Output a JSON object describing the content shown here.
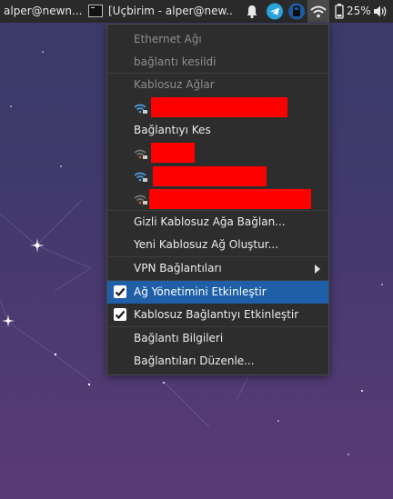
{
  "panel": {
    "tasks": [
      {
        "label": "alper@newn..."
      },
      {
        "label": "[Uçbirim - alper@new..."
      }
    ],
    "battery_percent": "25%"
  },
  "network_menu": {
    "ethernet_header": "Ethernet Ağı",
    "ethernet_status": "bağlantı kesildi",
    "wireless_header": "Kablosuz Ağlar",
    "disconnect_label": "Bağlantıyı Kes",
    "hidden_wifi_label": "Gizli Kablosuz Ağa Bağlan...",
    "new_wifi_label": "Yeni Kablosuz Ağ Oluştur...",
    "vpn_label": "VPN Bağlantıları",
    "enable_networking_label": "Ağ Yönetimini Etkinleştir",
    "enable_networking_checked": true,
    "enable_wireless_label": "Kablosuz Bağlantıyı Etkinleştir",
    "enable_wireless_checked": true,
    "connection_info_label": "Bağlantı Bilgileri",
    "edit_connections_label": "Bağlantıları Düzenle...",
    "redaction_color": "#ff0000",
    "highlight_color": "#1f5fa8"
  }
}
